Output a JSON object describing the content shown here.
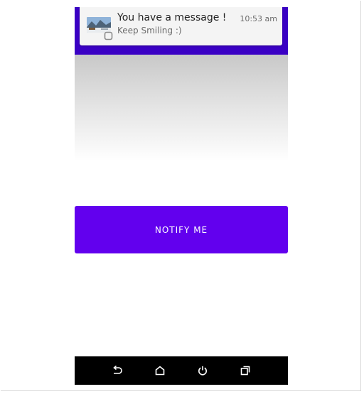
{
  "notification": {
    "title": "You have a message !",
    "text": "Keep Smiling :)",
    "time": "10:53 am",
    "thumbnail_icon": "landscape-thumbnail-icon",
    "small_icon": "app-small-icon"
  },
  "main": {
    "notify_button_label": "NOTIFY ME"
  },
  "nav_bar": {
    "icons": [
      "back-icon",
      "home-icon",
      "power-icon",
      "recents-icon"
    ]
  },
  "colors": {
    "status_bar": "#3a00c4",
    "button": "#6200ee",
    "nav_bar": "#000000"
  }
}
